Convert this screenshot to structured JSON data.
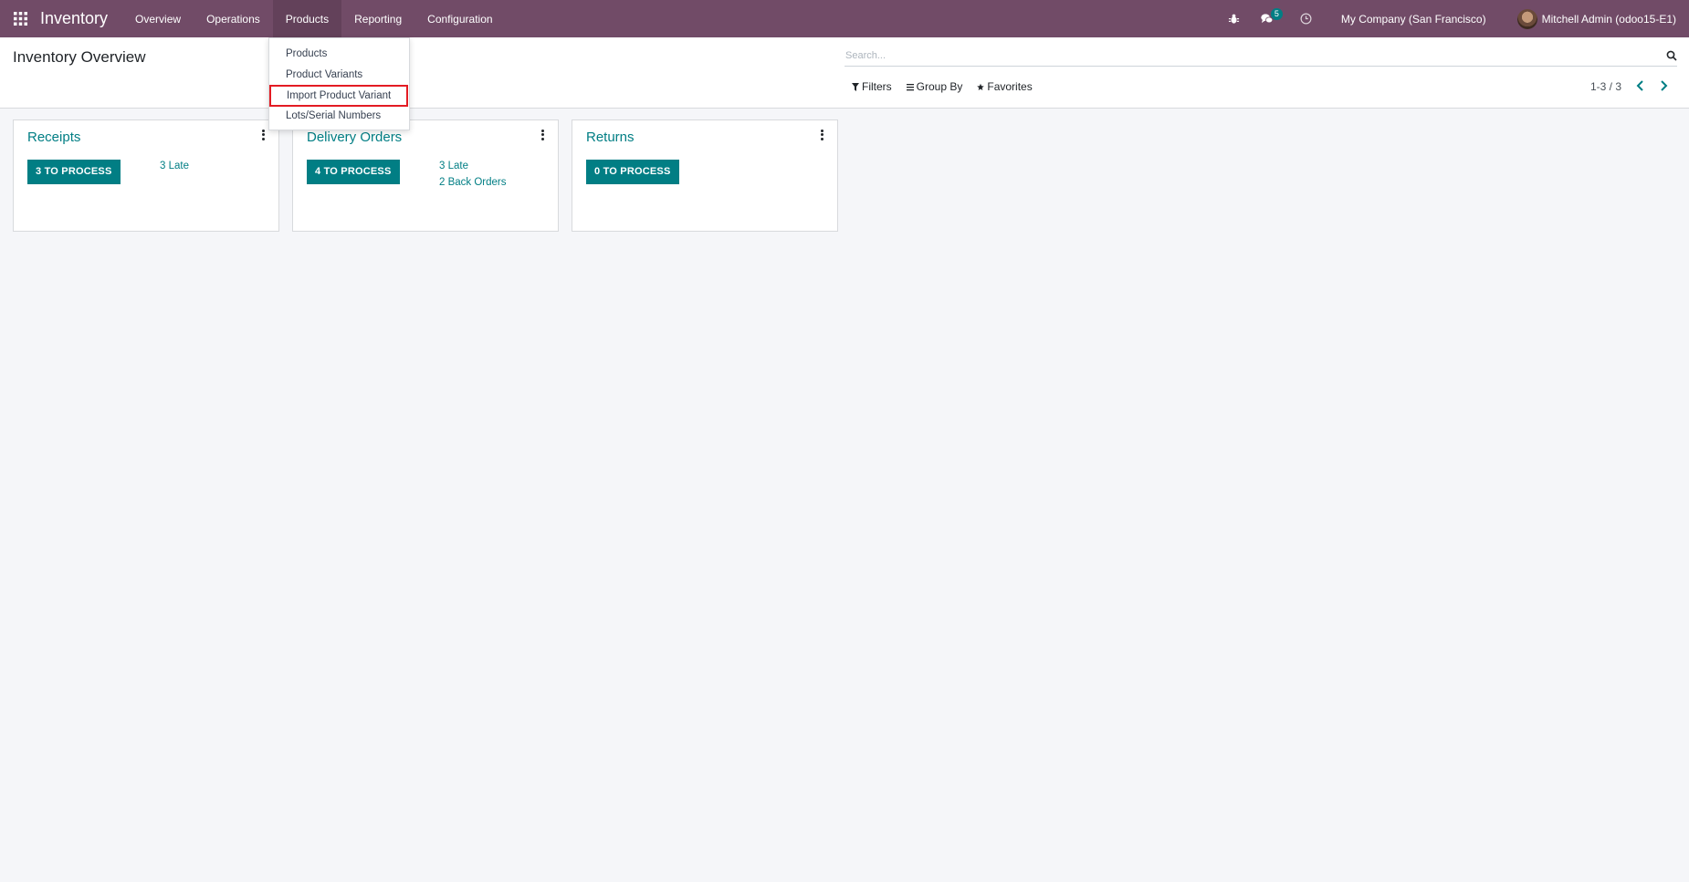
{
  "navbar": {
    "app_name": "Inventory",
    "menu": [
      "Overview",
      "Operations",
      "Products",
      "Reporting",
      "Configuration"
    ],
    "active_menu": "Products",
    "message_count": "5",
    "company": "My Company (San Francisco)",
    "user": "Mitchell Admin (odoo15-E1)",
    "colors": {
      "primary": "#714b67",
      "accent": "#017e84",
      "highlight": "#e31b23"
    }
  },
  "products_menu": {
    "items": [
      "Products",
      "Product Variants",
      "Import Product Variant",
      "Lots/Serial Numbers"
    ],
    "highlighted_item": "Import Product Variant"
  },
  "control_panel": {
    "title": "Inventory Overview",
    "search_placeholder": "Search...",
    "filters_label": "Filters",
    "group_by_label": "Group By",
    "favorites_label": "Favorites",
    "pager": "1-3 / 3"
  },
  "cards": [
    {
      "title": "Receipts",
      "button": "3 TO PROCESS",
      "links": [
        "3 Late"
      ]
    },
    {
      "title": "Delivery Orders",
      "button": "4 TO PROCESS",
      "links": [
        "3 Late",
        "2 Back Orders"
      ]
    },
    {
      "title": "Returns",
      "button": "0 TO PROCESS",
      "links": []
    }
  ],
  "icons": [
    "apps-grid-icon",
    "bug-icon",
    "chat-icon",
    "clock-icon",
    "search-icon",
    "filter-icon",
    "group-by-icon",
    "star-icon",
    "chevron-left-icon",
    "chevron-right-icon",
    "kebab-menu-icon"
  ]
}
